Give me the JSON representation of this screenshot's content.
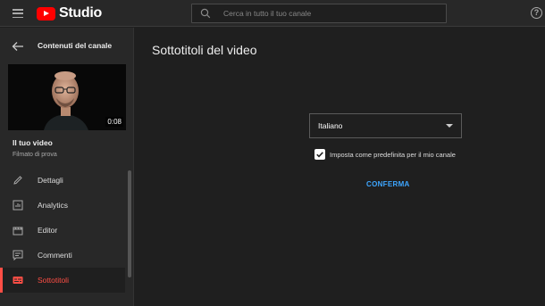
{
  "header": {
    "logo_text": "Studio",
    "search_placeholder": "Cerca in tutto il tuo canale",
    "help_symbol": "?",
    "brand_color": "#ff0000"
  },
  "sidebar": {
    "title": "Contenuti del canale",
    "video": {
      "duration": "0:08",
      "title": "Il tuo video",
      "subtitle": "Filmato di prova"
    },
    "items": [
      {
        "label": "Dettagli",
        "icon": "pencil-icon"
      },
      {
        "label": "Analytics",
        "icon": "analytics-icon"
      },
      {
        "label": "Editor",
        "icon": "clapperboard-icon"
      },
      {
        "label": "Commenti",
        "icon": "comment-icon"
      },
      {
        "label": "Sottotitoli",
        "icon": "subtitles-icon",
        "active": true
      }
    ],
    "active_color": "#ff4e45"
  },
  "main": {
    "title": "Sottotitoli del video",
    "language_select": {
      "value": "Italiano"
    },
    "default_checkbox": {
      "label": "Imposta come predefinita per il mio canale",
      "checked": true
    },
    "confirm_label": "CONFERMA",
    "accent_color": "#3ea6ff"
  }
}
